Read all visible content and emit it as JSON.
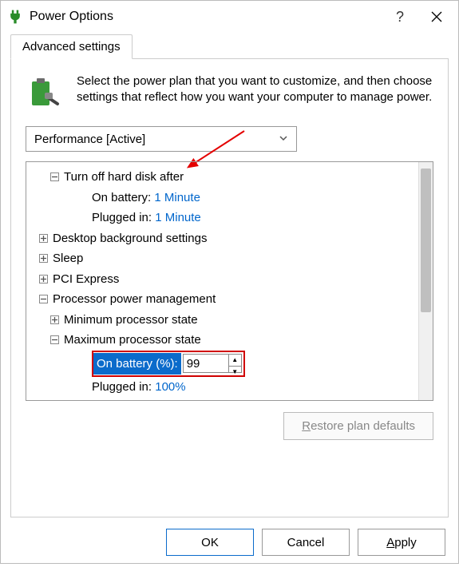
{
  "titlebar": {
    "title": "Power Options"
  },
  "tab_label": "Advanced settings",
  "intro_text": "Select the power plan that you want to customize, and then choose settings that reflect how you want your computer to manage power.",
  "plan_selected": "Performance [Active]",
  "tree": {
    "hard_disk": {
      "label": "Turn off hard disk after",
      "on_battery_label": "On battery:",
      "on_battery_value": "1 Minute",
      "plugged_in_label": "Plugged in:",
      "plugged_in_value": "1 Minute"
    },
    "desktop_bg": "Desktop background settings",
    "sleep": "Sleep",
    "pci": "PCI Express",
    "proc": {
      "label": "Processor power management",
      "min": "Minimum processor state",
      "max": {
        "label": "Maximum processor state",
        "on_battery_label": "On battery (%):",
        "on_battery_value": "99",
        "plugged_in_label": "Plugged in:",
        "plugged_in_value": "100%"
      }
    }
  },
  "restore_label": "Restore plan defaults",
  "buttons": {
    "ok": "OK",
    "cancel": "Cancel",
    "apply": "Apply"
  }
}
